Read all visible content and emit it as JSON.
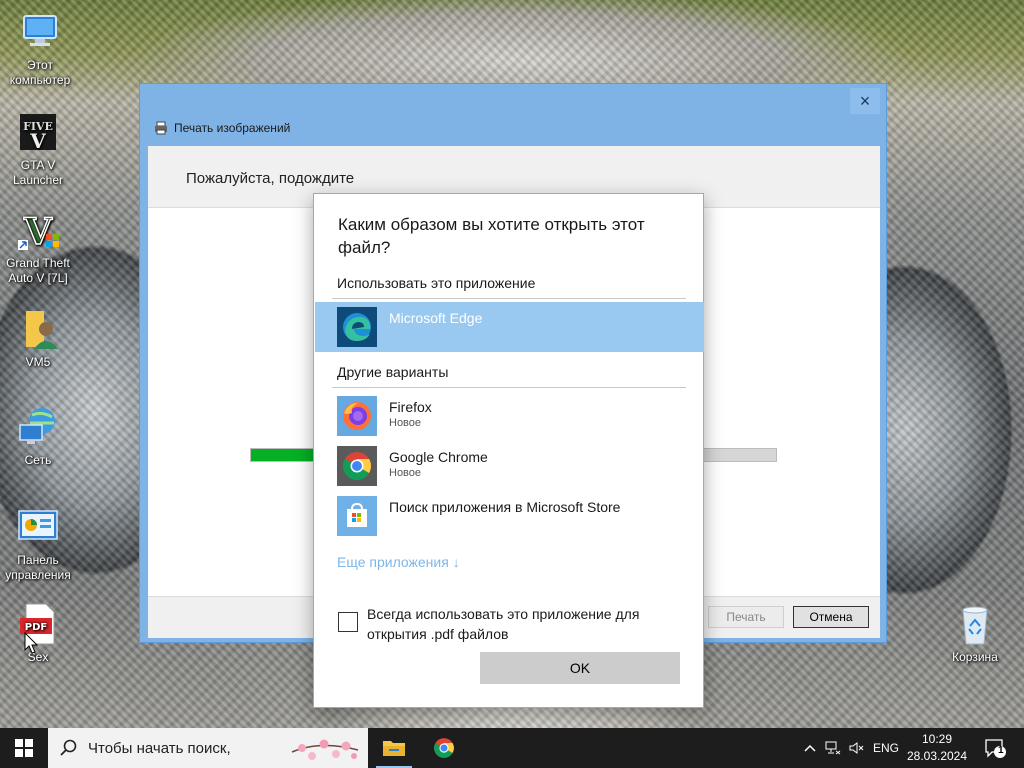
{
  "desktop": {
    "icons": [
      {
        "label": "Этот компьютер",
        "icon": "computer-icon"
      },
      {
        "label": "GTA V Launcher",
        "icon": "gta-launcher-icon"
      },
      {
        "label": "Grand Theft Auto V [7L]",
        "icon": "gta-v-icon"
      },
      {
        "label": "VM5",
        "icon": "user-folder-icon"
      },
      {
        "label": "Сеть",
        "icon": "network-icon"
      },
      {
        "label": "Панель управления",
        "icon": "control-panel-icon"
      },
      {
        "label": "Sex",
        "icon": "pdf-file-icon"
      },
      {
        "label": "Корзина",
        "icon": "recycle-bin-icon"
      }
    ]
  },
  "print_window": {
    "title": "Печать изображений",
    "close_label": "×",
    "status_text": "Пожалуйста, подождите",
    "print_button": "Печать",
    "cancel_button": "Отмена",
    "progress_fraction": 0.13
  },
  "open_with": {
    "question": "Каким образом вы хотите открыть этот файл?",
    "use_app_label": "Использовать это приложение",
    "recommended": {
      "name": "Microsoft Edge",
      "icon": "edge-icon"
    },
    "other_label": "Другие варианты",
    "others": [
      {
        "name": "Firefox",
        "sub": "Новое",
        "icon": "firefox-icon"
      },
      {
        "name": "Google Chrome",
        "sub": "Новое",
        "icon": "chrome-icon"
      },
      {
        "name": "Поиск приложения в Microsoft Store",
        "sub": "",
        "icon": "store-icon"
      }
    ],
    "more_apps": "Еще приложения ↓",
    "always_use": "Всегда использовать это приложение для открытия .pdf файлов",
    "always_use_checked": false,
    "ok_label": "OK"
  },
  "taskbar": {
    "search_placeholder": "Чтобы начать поиск,",
    "pinned": [
      {
        "name": "File Explorer",
        "icon": "folder-icon",
        "active": true
      },
      {
        "name": "Google Chrome",
        "icon": "chrome-icon",
        "active": false
      }
    ],
    "language": "ENG",
    "time": "10:29",
    "date": "28.03.2024",
    "notification_count": "1"
  },
  "colors": {
    "selection": "#99c9f0",
    "window_frame": "#7fb3e6",
    "progress": "#06b025",
    "link": "#7fb6e8",
    "taskbar": "#1d1d1d"
  }
}
